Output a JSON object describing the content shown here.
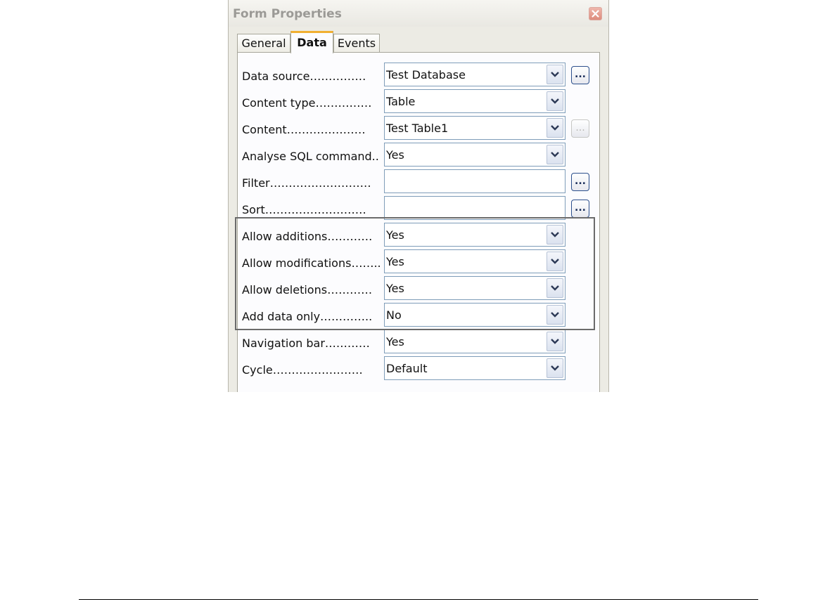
{
  "dialog": {
    "title": "Form Properties",
    "tabs": [
      {
        "label": "General",
        "active": false
      },
      {
        "label": "Data",
        "active": true
      },
      {
        "label": "Events",
        "active": false
      }
    ],
    "rows": [
      {
        "label": "Data source……………",
        "value": "Test Database",
        "type": "dropdown",
        "dots_button": "...",
        "dots_enabled": true
      },
      {
        "label": "Content type……………",
        "value": "Table",
        "type": "dropdown"
      },
      {
        "label": "Content…………………",
        "value": "Test Table1",
        "type": "dropdown",
        "dots_button": "...",
        "dots_enabled": false
      },
      {
        "label": "Analyse SQL command....",
        "value": "Yes",
        "type": "dropdown"
      },
      {
        "label": "Filter………………………",
        "value": "",
        "type": "text",
        "dots_button": "...",
        "dots_enabled": true
      },
      {
        "label": "Sort………………………",
        "value": "",
        "type": "text",
        "dots_button": "...",
        "dots_enabled": true
      },
      {
        "label": "Allow additions…………",
        "value": "Yes",
        "type": "dropdown"
      },
      {
        "label": "Allow modifications……..",
        "value": "Yes",
        "type": "dropdown"
      },
      {
        "label": "Allow deletions…………",
        "value": "Yes",
        "type": "dropdown"
      },
      {
        "label": "Add data only…………..",
        "value": "No",
        "type": "dropdown"
      },
      {
        "label": "Navigation bar…………",
        "value": "Yes",
        "type": "dropdown"
      },
      {
        "label": "Cycle……………………",
        "value": "Default",
        "type": "dropdown"
      }
    ]
  }
}
